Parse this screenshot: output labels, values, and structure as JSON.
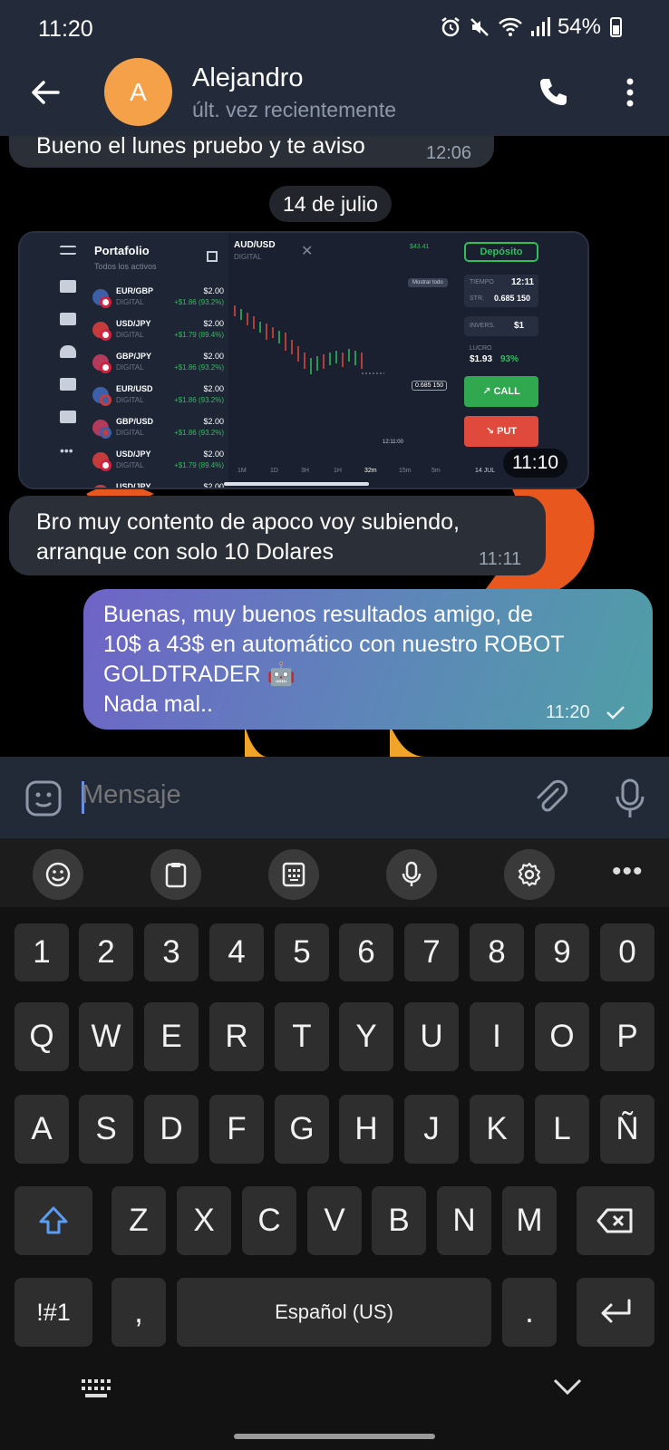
{
  "status_bar": {
    "time": "11:20",
    "battery": "54%",
    "icons": [
      "alarm-icon",
      "mute-icon",
      "wifi-icon",
      "signal-icon",
      "battery-icon"
    ]
  },
  "header": {
    "back_icon": "arrow-left-icon",
    "avatar_letter": "A",
    "avatar_color": "#f5a14a",
    "contact_name": "Alejandro",
    "contact_status": "últ. vez recientemente",
    "call_icon": "phone-icon",
    "more_icon": "more-vertical-icon"
  },
  "chat": {
    "messages_before": [
      {
        "text": "Bueno el lunes pruebo y te aviso",
        "time": "12:06"
      }
    ],
    "date_separator": "14 de julio",
    "image_message": {
      "time": "11:10",
      "screenshot": {
        "title": "Portafolio",
        "subtitle": "Todos los activos",
        "assets": [
          {
            "pair": "EUR/GBP",
            "type": "DIGITAL",
            "amount": "$2.00",
            "profit": "+$1.86 (93.2%)"
          },
          {
            "pair": "USD/JPY",
            "type": "DIGITAL",
            "amount": "$2.00",
            "profit": "+$1.79 (89.4%)"
          },
          {
            "pair": "GBP/JPY",
            "type": "DIGITAL",
            "amount": "$2.00",
            "profit": "+$1.86 (93.2%)"
          },
          {
            "pair": "EUR/USD",
            "type": "DIGITAL",
            "amount": "$2.00",
            "profit": "+$1.86 (93.2%)"
          },
          {
            "pair": "GBP/USD",
            "type": "DIGITAL",
            "amount": "$2.00",
            "profit": "+$1.86 (93.2%)"
          },
          {
            "pair": "USD/JPY",
            "type": "DIGITAL",
            "amount": "$2.00",
            "profit": "+$1.79 (89.4%)"
          },
          {
            "pair": "USD/JPY",
            "type": "",
            "amount": "$2.00",
            "profit": ""
          }
        ],
        "active_tab": "AUD/USD",
        "active_tab_sub": "DIGITAL",
        "balance": "$43.41",
        "deposit_label": "Depósito",
        "show_all": "Mostrar todo",
        "time_label": "TIEMPO",
        "time_value": "12:11",
        "strike_label": "STR.",
        "strike_value": "0.685 150",
        "invest_label": "INVERS.",
        "invest_value": "$1",
        "profit_label": "LUCRO",
        "profit_value": "$1.93",
        "profit_pct": "93%",
        "call_label": "CALL",
        "put_label": "PUT",
        "price_label": "0.685 150",
        "chart_time": "12:11:00",
        "timeframes": [
          "1M",
          "1D",
          "3H",
          "1H",
          "32m",
          "15m",
          "5m"
        ],
        "date_label": "14 JUL"
      }
    },
    "incoming_message": {
      "lines": [
        "Bro muy contento de apoco voy subiendo,",
        "arranque con solo 10 Dolares"
      ],
      "time": "11:11"
    },
    "outgoing_message": {
      "lines": [
        "Buenas, muy buenos resultados amigo, de",
        "10$ a 43$ en automático con nuestro ROBOT",
        "GOLDTRADER 🤖",
        "Nada mal.."
      ],
      "time": "11:20",
      "status_icon": "check-icon"
    }
  },
  "input_bar": {
    "emoji_icon": "sticker-icon",
    "placeholder": "Mensaje",
    "attach_icon": "paperclip-icon",
    "mic_icon": "microphone-icon"
  },
  "keyboard": {
    "toolbar": [
      "emoji-icon",
      "clipboard-icon",
      "keyboard-layout-icon",
      "voice-input-icon",
      "settings-icon",
      "more-horizontal-icon"
    ],
    "row_numbers": [
      "1",
      "2",
      "3",
      "4",
      "5",
      "6",
      "7",
      "8",
      "9",
      "0"
    ],
    "row_1": [
      "Q",
      "W",
      "E",
      "R",
      "T",
      "Y",
      "U",
      "I",
      "O",
      "P"
    ],
    "row_2": [
      "A",
      "S",
      "D",
      "F",
      "G",
      "H",
      "J",
      "K",
      "L",
      "Ñ"
    ],
    "row_3": [
      "Z",
      "X",
      "C",
      "V",
      "B",
      "N",
      "M"
    ],
    "symbols_key": "!#1",
    "comma_key": ",",
    "space_label": "Español (US)",
    "period_key": ".",
    "shift_icon": "shift-icon",
    "backspace_icon": "backspace-icon",
    "enter_icon": "enter-icon"
  },
  "nav_bar": {
    "keyboard_switch_icon": "keyboard-icon",
    "hide_keyboard_icon": "chevron-down-icon"
  }
}
